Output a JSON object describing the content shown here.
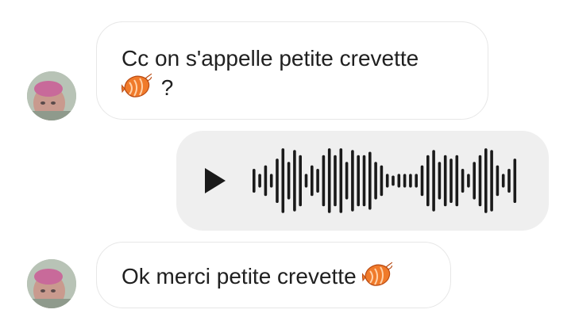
{
  "messages": [
    {
      "direction": "incoming",
      "line1": "Cc on s'appelle petite crevette",
      "line2_suffix": " ?",
      "emoji": "shrimp-emoji"
    },
    {
      "direction": "outgoing",
      "type": "voice-message",
      "play_icon": "play-icon"
    },
    {
      "direction": "incoming",
      "text": "Ok merci petite crevette",
      "emoji": "shrimp-emoji"
    }
  ],
  "colors": {
    "incoming_bubble_border": "#e7e7e7",
    "outgoing_bubble_bg": "#efefef",
    "waveform": "#1a1a1a",
    "shrimp": "#f07a2a"
  },
  "waveform_levels": [
    0.35,
    0.2,
    0.45,
    0.2,
    0.65,
    0.95,
    0.55,
    0.9,
    0.75,
    0.2,
    0.45,
    0.35,
    0.75,
    0.95,
    0.75,
    0.95,
    0.55,
    0.9,
    0.75,
    0.75,
    0.85,
    0.55,
    0.45,
    0.2,
    0.15,
    0.2,
    0.2,
    0.2,
    0.2,
    0.45,
    0.75,
    0.9,
    0.55,
    0.75,
    0.65,
    0.75,
    0.35,
    0.2,
    0.55,
    0.75,
    0.95,
    0.9,
    0.45,
    0.2,
    0.35,
    0.65
  ]
}
